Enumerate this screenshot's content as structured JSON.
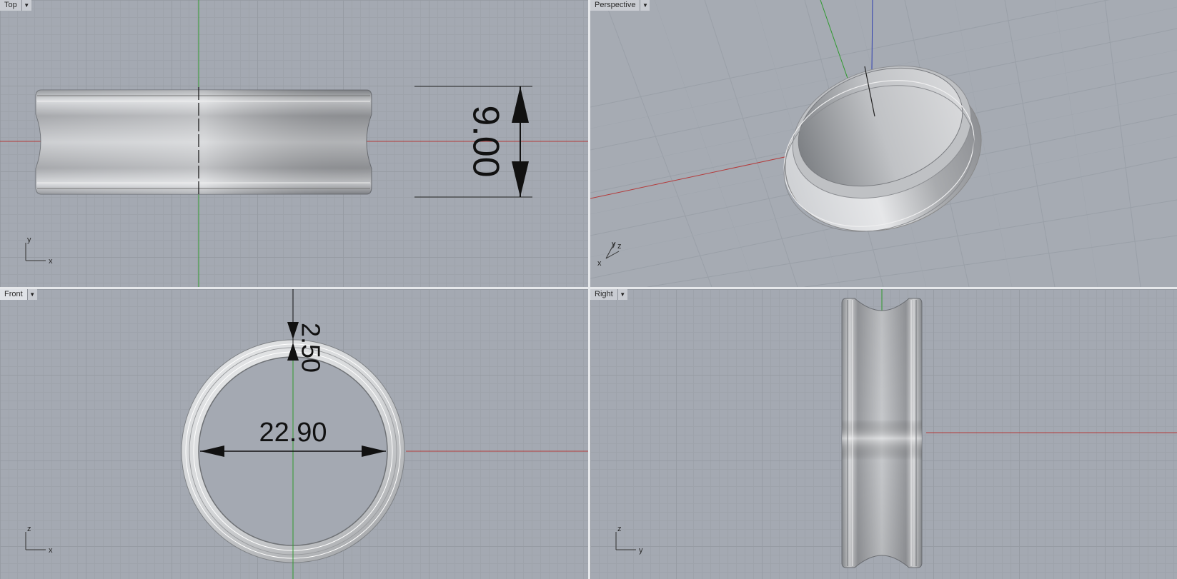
{
  "viewports": {
    "top": {
      "label": "Top",
      "dimension": "9.00",
      "axes": {
        "a": "y",
        "b": "x"
      }
    },
    "perspective": {
      "label": "Perspective",
      "axes": {
        "a": "y",
        "b": "z",
        "c": "x"
      }
    },
    "front": {
      "label": "Front",
      "dim_outer": "2.50",
      "dim_inner": "22.90",
      "axes": {
        "a": "z",
        "b": "x"
      }
    },
    "right": {
      "label": "Right",
      "axes": {
        "a": "z",
        "b": "y"
      }
    }
  },
  "colors": {
    "x_axis": "#b43a3a",
    "y_axis": "#2f9a2f",
    "z_axis": "#2f3fb0",
    "active_title": "#dfe2e7"
  },
  "icons": {
    "viewport_menu": "chevron-down-icon"
  }
}
